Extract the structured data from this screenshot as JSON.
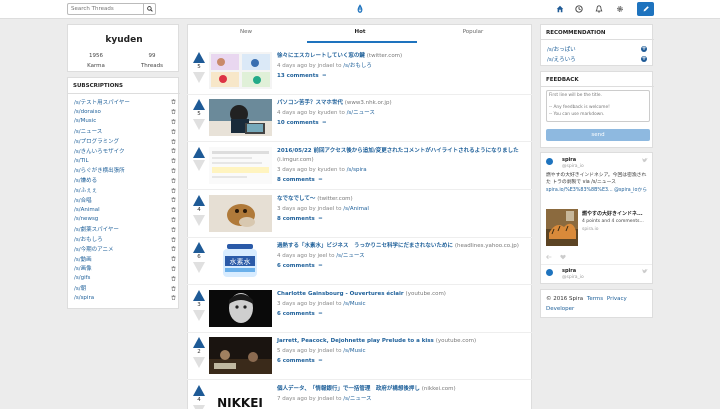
{
  "search": {
    "placeholder": "Search Threads"
  },
  "profile": {
    "name": "kyuden",
    "karma_value": "1956",
    "karma_label": "Karma",
    "threads_value": "99",
    "threads_label": "Threads"
  },
  "subscriptions": {
    "title": "SUBSCRIPTIONS",
    "items": [
      "/s/テスト用スパイヤー",
      "/s/doraiso",
      "/s/Music",
      "/s/ニュース",
      "/s/プログラミング",
      "/s/きんいろモザイク",
      "/s/TIL",
      "/s/らぐがき横出張所",
      "/s/嫌める",
      "/s/ふぇぇ",
      "/s/合唱",
      "/s/Animal",
      "/s/newsg",
      "/s/劇薬スパイヤー",
      "/s/おもしろ",
      "/s/今期のアニメ",
      "/s/動画",
      "/s/画像",
      "/s/gifs",
      "/s/朝",
      "/s/spira"
    ]
  },
  "tabs": {
    "new": "New",
    "hot": "Hot",
    "popular": "Popular"
  },
  "posts": [
    {
      "score": "5",
      "title": "徐々にエスカレートしていく窓の鍵",
      "domain": "(twitter.com)",
      "meta_prefix": "4 days ago by jndael to",
      "sub": "/s/おもしろ",
      "comments": "13 comments"
    },
    {
      "score": "5",
      "title": "パソコン苦手？スマホ世代",
      "domain": "(www3.nhk.or.jp)",
      "meta_prefix": "4 days ago by kyuden to",
      "sub": "/s/ニュース",
      "comments": "10 comments"
    },
    {
      "score": "",
      "title": "2016/05/22 前回アクセス後から追加/変更されたコメントがハイライトされるようになりました",
      "domain": "(i.imgur.com)",
      "meta_prefix": "3 days ago by kyuden to",
      "sub": "/s/spira",
      "comments": "8 comments"
    },
    {
      "score": "4",
      "title": "なでなでして～",
      "domain": "(twitter.com)",
      "meta_prefix": "3 days ago by jndael to",
      "sub": "/s/Animal",
      "comments": "8 comments"
    },
    {
      "score": "6",
      "title": "過熱する「水素水」ビジネス　うっかりニセ科学にだまされないために",
      "domain": "(headlines.yahoo.co.jp)",
      "meta_prefix": "4 days ago by jeel to",
      "sub": "/s/ニュース",
      "comments": "6 comments"
    },
    {
      "score": "3",
      "title": "Charlotte Gainsbourg - Ouvertures éclair",
      "domain": "(youtube.com)",
      "meta_prefix": "3 days ago by jndael to",
      "sub": "/s/Music",
      "comments": "6 comments"
    },
    {
      "score": "2",
      "title": "Jarrett, Peacock, Dejohnette play Prelude to a kiss",
      "domain": "(youtube.com)",
      "meta_prefix": "5 days ago by jndael to",
      "sub": "/s/Music",
      "comments": "6 comments"
    },
    {
      "score": "4",
      "title": "個人データ、「情報銀行」で一括管理　政府が構想後押し",
      "domain": "(nikkei.com)",
      "meta_prefix": "7 days ago by jndael to",
      "sub": "/s/ニュース",
      "comments": ""
    }
  ],
  "recommendation": {
    "title": "RECOMMENDATION",
    "items": [
      "/s/おっぱい",
      "/s/えろいろ"
    ]
  },
  "feedback": {
    "title": "FEEDBACK",
    "placeholder": "First line will be the title.\n\n-- Any feedback is welcome!\n-- You can use markdown.",
    "send": "send"
  },
  "tweet": {
    "name": "spira",
    "handle": "@spira_io",
    "text": "燃やすの大好きインドネシア。今回は密漁された トラの剥製で via /s/ニュース",
    "link": "spira.io/%E3%83%8B%E3... @spira_ioから",
    "card_title": "燃やすの大好きインドネ...",
    "card_meta": "4 points and 4 comments...",
    "card_domain": "spira.io",
    "name2": "spira",
    "handle2": "@spira_io"
  },
  "footer": {
    "copyright": "© 2016 Spira",
    "terms": "Terms",
    "privacy": "Privacy",
    "developer": "Developer"
  },
  "colors": {
    "accent": "#1e73be",
    "vote_up": "#1e5a96",
    "link": "#1d5f99"
  }
}
